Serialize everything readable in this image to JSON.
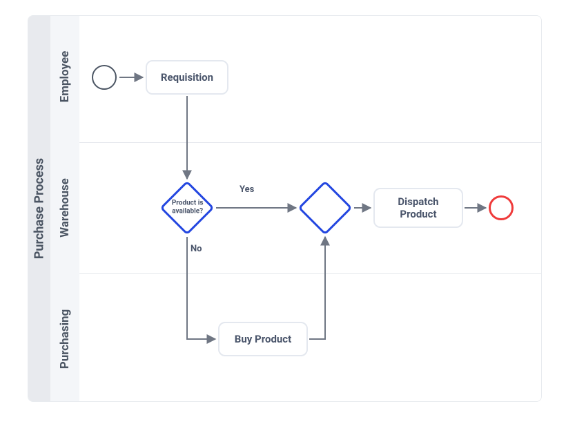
{
  "pool": {
    "title": "Purchase Process"
  },
  "lanes": {
    "employee": {
      "label": "Employee"
    },
    "warehouse": {
      "label": "Warehouse"
    },
    "purchasing": {
      "label": "Purchasing"
    }
  },
  "tasks": {
    "requisition": {
      "label": "Requisition"
    },
    "dispatch": {
      "label": "Dispatch Product"
    },
    "buy": {
      "label": "Buy Product"
    }
  },
  "gateways": {
    "available": {
      "question": "Product is available?"
    }
  },
  "edgeLabels": {
    "yes": "Yes",
    "no": "No"
  },
  "colors": {
    "accent": "#2346e0",
    "end": "#ef3b3b",
    "text": "#49546a",
    "line": "#9aa1ab"
  }
}
